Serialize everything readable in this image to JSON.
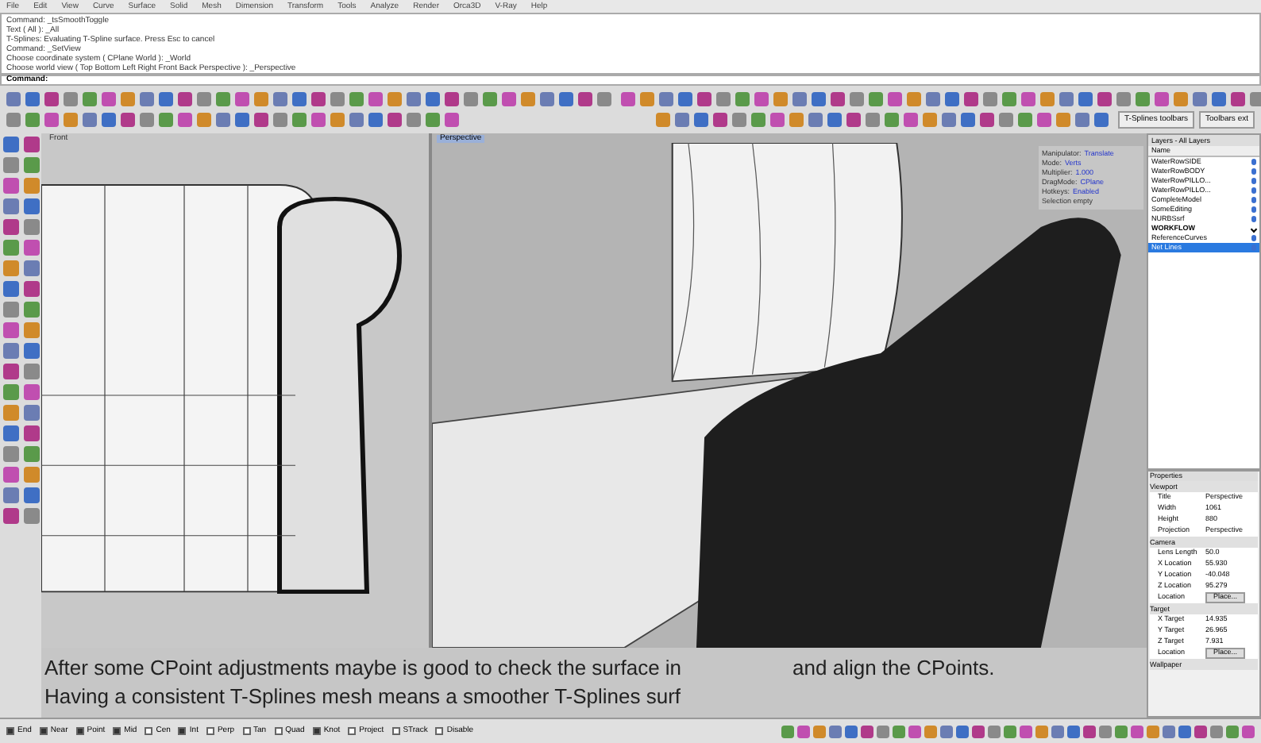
{
  "menu": [
    "File",
    "Edit",
    "View",
    "Curve",
    "Surface",
    "Solid",
    "Mesh",
    "Dimension",
    "Transform",
    "Tools",
    "Analyze",
    "Render",
    "Orca3D",
    "V-Ray",
    "Help"
  ],
  "command_history": [
    "Command: _tsSmoothToggle",
    "Text ( All ): _All",
    "T-Splines: Evaluating T-Spline surface. Press Esc to cancel",
    "Command: _SetView",
    "Choose coordinate system ( CPlane World ): _World",
    "Choose world view ( Top Bottom Left Right Front Back Perspective ): _Perspective"
  ],
  "command_prompt": "Command:",
  "toolbar_tabs": [
    "T-Splines toolbars",
    "Toolbars ext"
  ],
  "viewports": [
    {
      "title": "Front",
      "selected": false
    },
    {
      "title": "Perspective",
      "selected": true
    }
  ],
  "manipulator": [
    {
      "label": "Manipulator:",
      "value": "Translate"
    },
    {
      "label": "Mode:",
      "value": "Verts"
    },
    {
      "label": "Multiplier:",
      "value": "1.000"
    },
    {
      "label": "DragMode:",
      "value": "CPlane"
    },
    {
      "label": "Hotkeys:",
      "value": "Enabled"
    },
    {
      "label": "Selection empty"
    }
  ],
  "subtitles": [
    [
      "After some CPoint adjustments maybe is good to check the surface in",
      "and align the CPoints."
    ],
    [
      "Having a consistent T-Splines mesh means a smoother T-Splines surf"
    ]
  ],
  "layers": {
    "title": "Layers - All Layers",
    "column": "Name",
    "items": [
      {
        "name": "WaterRowSIDE",
        "current": false,
        "selected": false
      },
      {
        "name": "WaterRowBODY",
        "current": false,
        "selected": false
      },
      {
        "name": "WaterRowPILLO...",
        "current": false,
        "selected": false
      },
      {
        "name": "WaterRowPILLO...",
        "current": false,
        "selected": false
      },
      {
        "name": "CompleteModel",
        "current": false,
        "selected": false
      },
      {
        "name": "SomeEditing",
        "current": false,
        "selected": false
      },
      {
        "name": "NURBSsrf",
        "current": false,
        "selected": false
      },
      {
        "name": "WORKFLOW",
        "current": true,
        "selected": false
      },
      {
        "name": "ReferenceCurves",
        "current": false,
        "selected": false
      },
      {
        "name": "Net Lines",
        "current": false,
        "selected": true
      }
    ]
  },
  "properties": {
    "title": "Properties",
    "sections": [
      {
        "name": "Viewport",
        "rows": [
          {
            "kind": "text",
            "label": "Title",
            "value": "Perspective"
          },
          {
            "kind": "text",
            "label": "Width",
            "value": "1061"
          },
          {
            "kind": "text",
            "label": "Height",
            "value": "880"
          },
          {
            "kind": "text",
            "label": "Projection",
            "value": "Perspective"
          }
        ]
      },
      {
        "name": "Camera",
        "rows": [
          {
            "kind": "text",
            "label": "Lens Length",
            "value": "50.0"
          },
          {
            "kind": "text",
            "label": "X Location",
            "value": "55.930"
          },
          {
            "kind": "text",
            "label": "Y Location",
            "value": "-40.048"
          },
          {
            "kind": "text",
            "label": "Z Location",
            "value": "95.279"
          },
          {
            "kind": "button",
            "label": "Location",
            "value": "Place..."
          }
        ]
      },
      {
        "name": "Target",
        "rows": [
          {
            "kind": "text",
            "label": "X Target",
            "value": "14.935"
          },
          {
            "kind": "text",
            "label": "Y Target",
            "value": "26.965"
          },
          {
            "kind": "text",
            "label": "Z Target",
            "value": "7.931"
          },
          {
            "kind": "button",
            "label": "Location",
            "value": "Place..."
          }
        ]
      },
      {
        "name": "Wallpaper"
      }
    ]
  },
  "osnaps": [
    {
      "label": "End",
      "checked": true
    },
    {
      "label": "Near",
      "checked": true
    },
    {
      "label": "Point",
      "checked": true
    },
    {
      "label": "Mid",
      "checked": true
    },
    {
      "label": "Cen",
      "checked": false
    },
    {
      "label": "Int",
      "checked": true
    },
    {
      "label": "Perp",
      "checked": false
    },
    {
      "label": "Tan",
      "checked": false
    },
    {
      "label": "Quad",
      "checked": false
    },
    {
      "label": "Knot",
      "checked": true
    },
    {
      "label": "Project",
      "checked": false
    },
    {
      "label": "STrack",
      "checked": false
    },
    {
      "label": "Disable",
      "checked": false
    }
  ]
}
